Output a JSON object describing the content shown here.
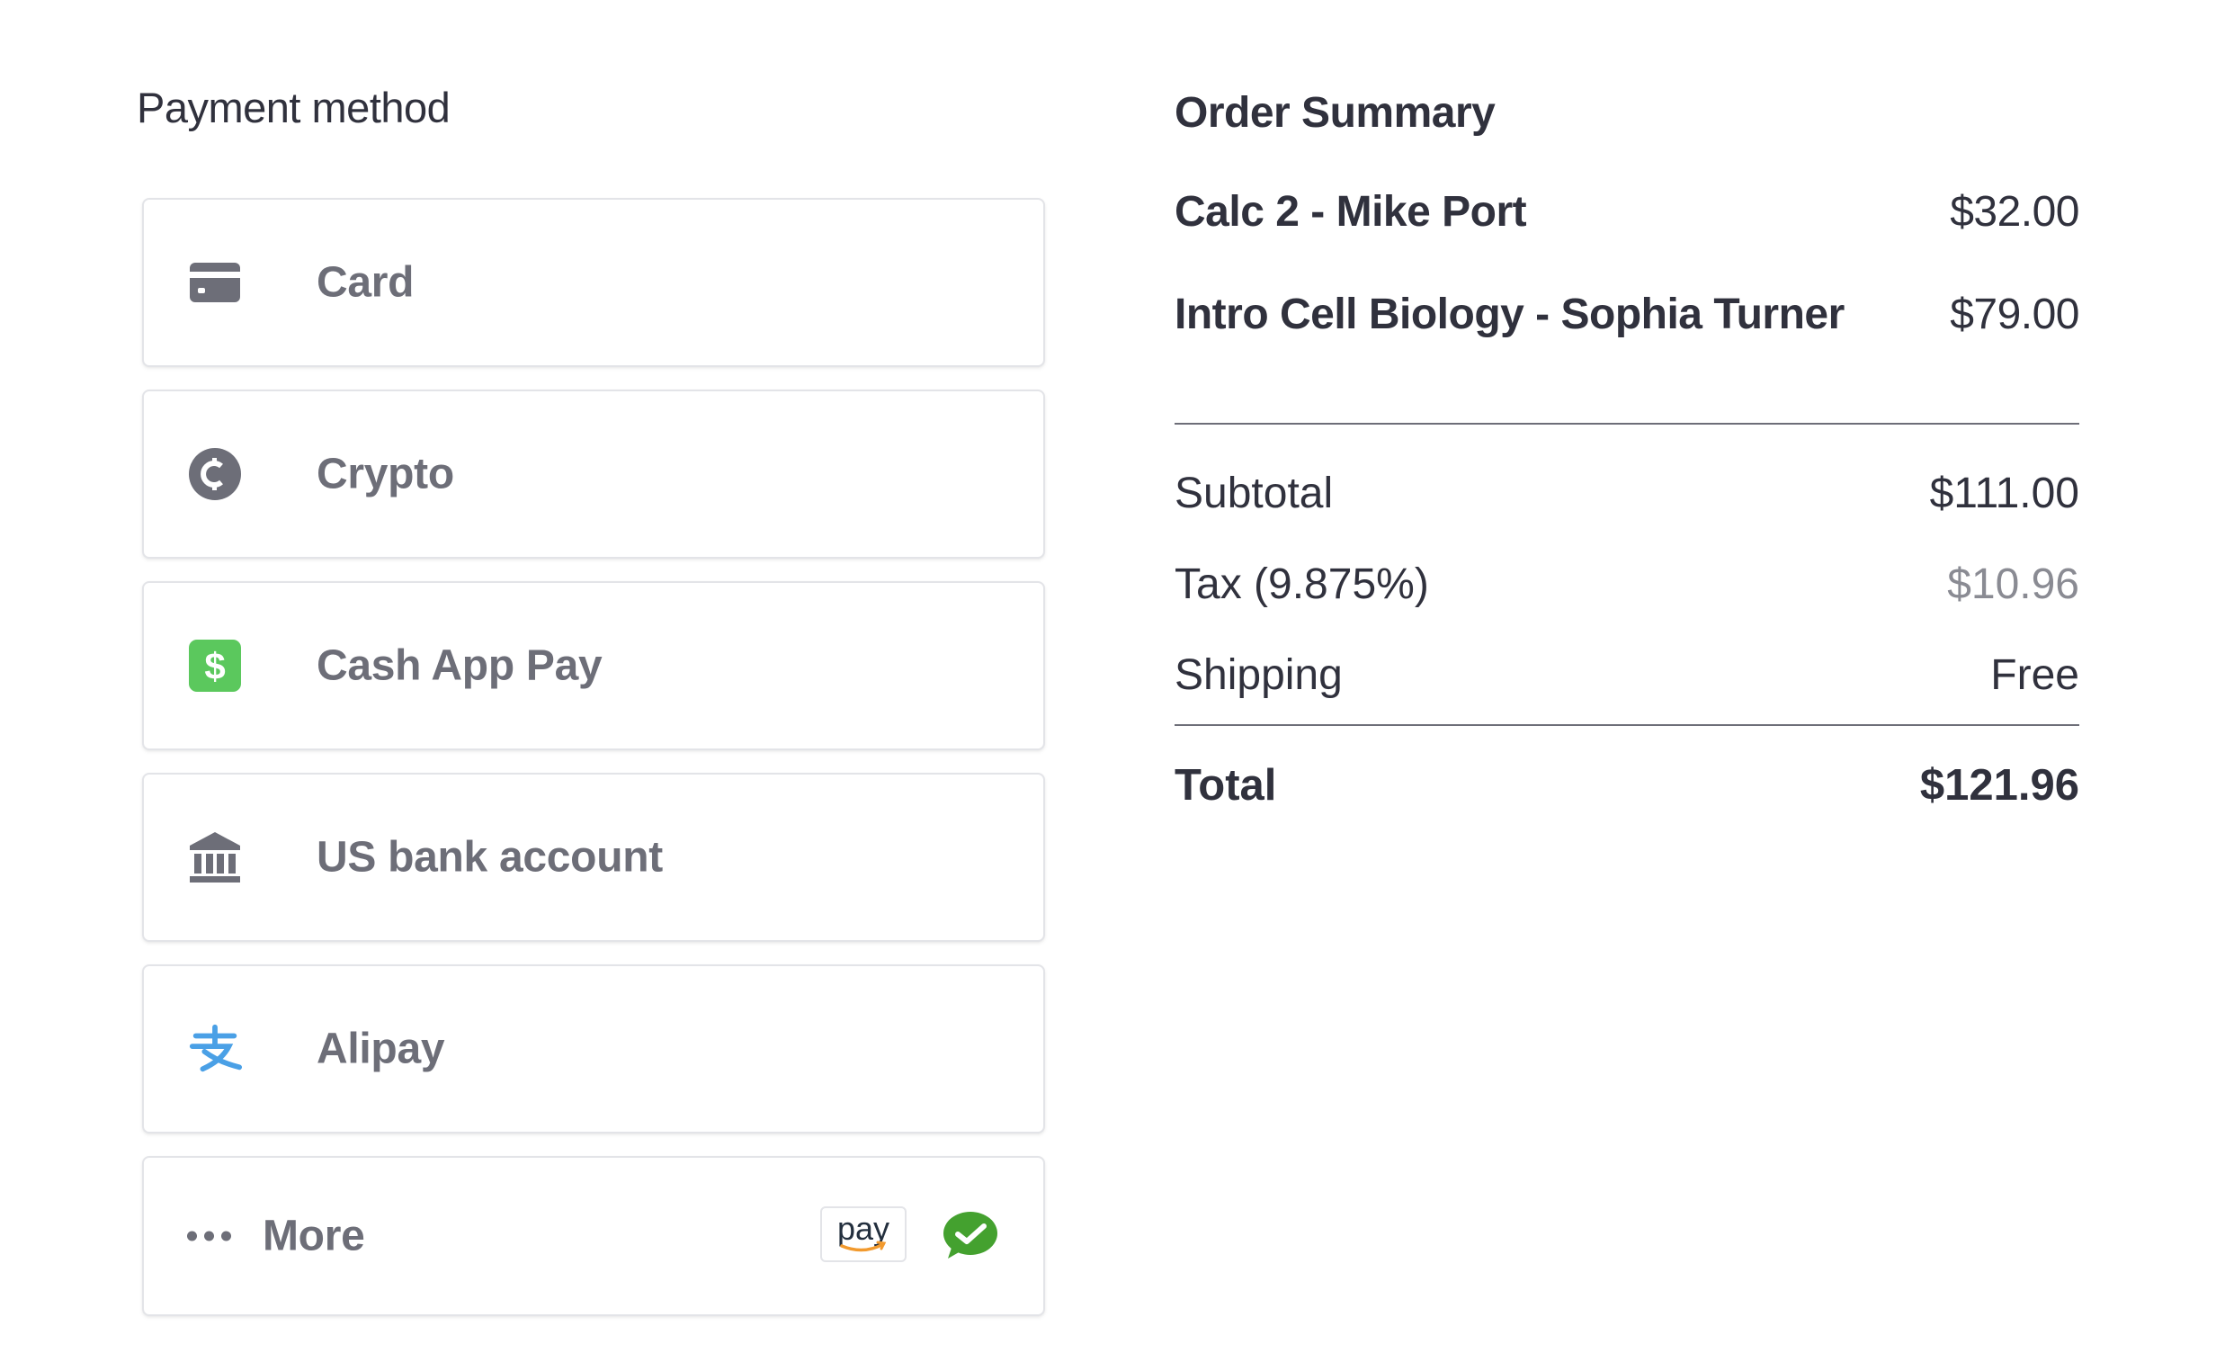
{
  "payment": {
    "title": "Payment method",
    "methods": [
      {
        "label": "Card",
        "icon": "credit-card-icon"
      },
      {
        "label": "Crypto",
        "icon": "crypto-coin-icon"
      },
      {
        "label": "Cash App Pay",
        "icon": "cash-app-icon"
      },
      {
        "label": "US bank account",
        "icon": "bank-icon"
      },
      {
        "label": "Alipay",
        "icon": "alipay-icon"
      }
    ],
    "more": {
      "label": "More",
      "icons": [
        "amazon-pay-icon",
        "wechat-pay-icon"
      ],
      "amazon_pay_text": "pay"
    }
  },
  "summary": {
    "title": "Order Summary",
    "items": [
      {
        "name": "Calc 2 - Mike Port",
        "price": "$32.00"
      },
      {
        "name": "Intro Cell Biology - Sophia Turner",
        "price": "$79.00"
      }
    ],
    "subtotal": {
      "label": "Subtotal",
      "value": "$111.00"
    },
    "tax": {
      "label": "Tax (9.875%)",
      "value": "$10.96"
    },
    "shipping": {
      "label": "Shipping",
      "value": "Free"
    },
    "total": {
      "label": "Total",
      "value": "$121.96"
    }
  },
  "colors": {
    "text": "#30313d",
    "muted": "#6d6e78",
    "border": "#e3e4e8",
    "cash_app_green": "#5bc85d",
    "alipay_blue": "#4aa0e6",
    "wechat_green": "#44a12f",
    "amazon_orange": "#f29a2e"
  }
}
